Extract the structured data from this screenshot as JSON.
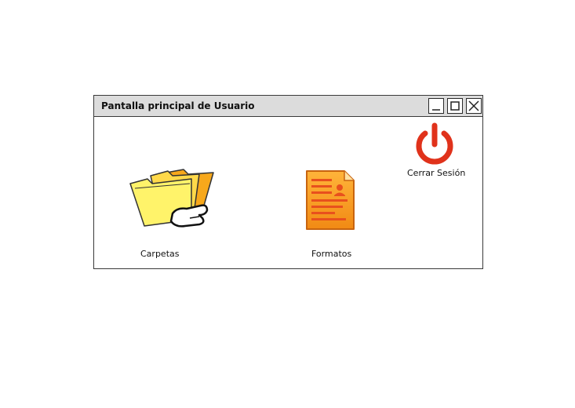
{
  "window": {
    "title": "Pantalla principal de Usuario",
    "controls": {
      "minimize_icon": "minimize-icon",
      "maximize_icon": "maximize-icon",
      "close_icon": "close-icon"
    }
  },
  "main": {
    "tiles": [
      {
        "label": "Carpetas",
        "icon": "folders-hand-icon"
      },
      {
        "label": "Formatos",
        "icon": "document-form-icon"
      }
    ],
    "logout": {
      "label": "Cerrar Sesión",
      "icon": "power-icon",
      "color": "#e0321b"
    }
  },
  "colors": {
    "titlebar": "#dcdcdc",
    "border": "#3a3a3a",
    "folder_yellow": "#fff36a",
    "folder_orange": "#f7a81b",
    "document_orange": "#f39a1e",
    "document_lines": "#e8501d",
    "power_red": "#e0321b"
  }
}
